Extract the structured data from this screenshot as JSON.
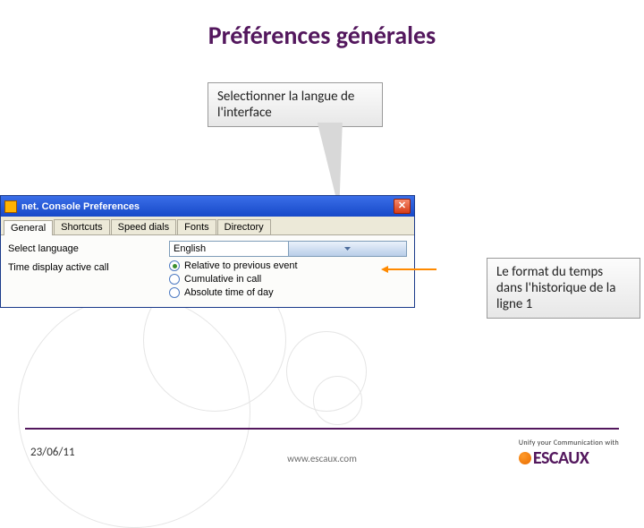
{
  "title": "Préférences générales",
  "callouts": {
    "language": "Selectionner la langue de l'interface",
    "time_format": "Le format du temps dans l'historique de la ligne 1"
  },
  "window": {
    "title": "net. Console Preferences",
    "tabs": [
      "General",
      "Shortcuts",
      "Speed dials",
      "Fonts",
      "Directory"
    ],
    "fields": {
      "select_language_label": "Select language",
      "time_display_label": "Time display active call",
      "language_value": "English",
      "radios": [
        "Relative to previous event",
        "Cumulative in call",
        "Absolute time of day"
      ]
    }
  },
  "footer": {
    "date": "23/06/11",
    "url": "www.escaux.com",
    "tagline": "Unify your Communication with",
    "brand": "ESCAUX"
  }
}
